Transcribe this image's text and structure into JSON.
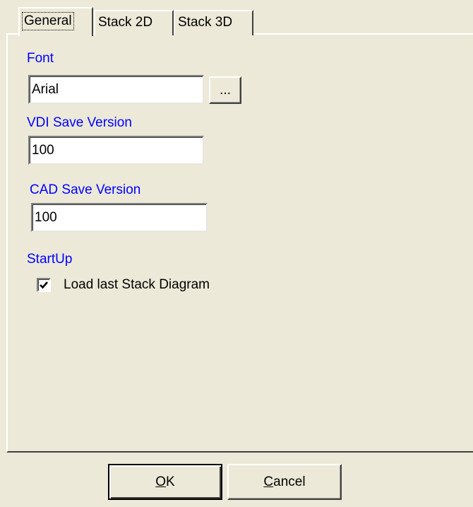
{
  "tabs": {
    "general": "General",
    "stack2d": "Stack 2D",
    "stack3d": "Stack 3D"
  },
  "font": {
    "label": "Font",
    "value": "Arial",
    "browse_label": "..."
  },
  "vdi_save_version": {
    "label": "VDI Save Version",
    "value": "100"
  },
  "cad_save_version": {
    "label": "CAD Save Version",
    "value": "100"
  },
  "startup": {
    "label": "StartUp",
    "load_last_label": "Load last Stack Diagram",
    "load_last_checked": true
  },
  "buttons": {
    "ok_mnemonic": "O",
    "ok_rest": "K",
    "cancel_mnemonic": "C",
    "cancel_rest": "ancel"
  },
  "icons": {
    "checkmark": "check-icon"
  }
}
